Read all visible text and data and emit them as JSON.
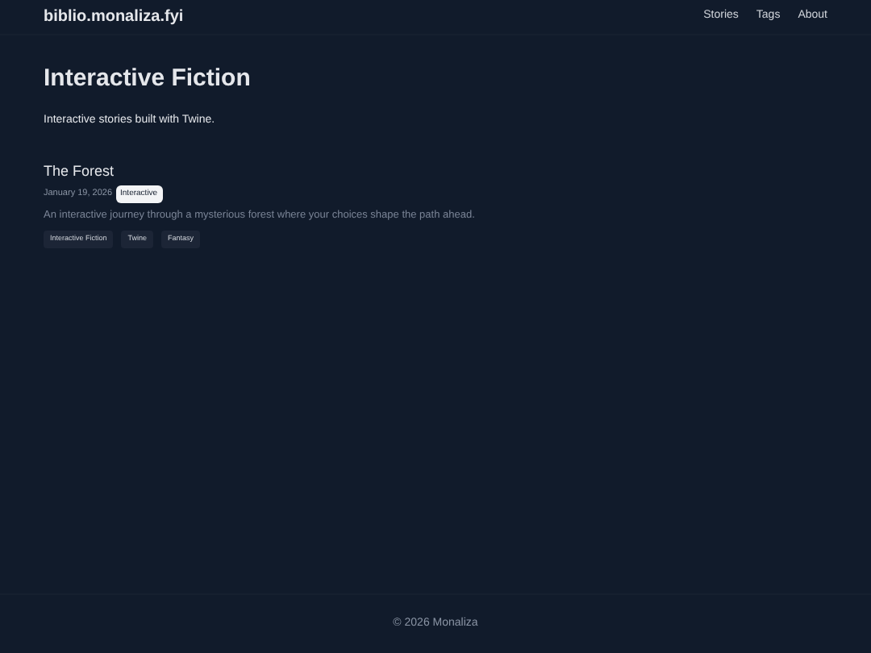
{
  "site": {
    "title": "biblio.monaliza.fyi"
  },
  "nav": [
    "Stories",
    "Tags",
    "About"
  ],
  "heading": "Interactive Fiction",
  "intro": "Interactive stories built with Twine.",
  "stories": [
    {
      "title": "The Forest",
      "date": "January 19, 2026",
      "badge": "Interactive",
      "description": "An interactive journey through a mysterious forest where your choices shape the path ahead.",
      "tags": [
        "Interactive Fiction",
        "Twine",
        "Fantasy"
      ]
    }
  ],
  "footer": "© 2026 Monaliza"
}
